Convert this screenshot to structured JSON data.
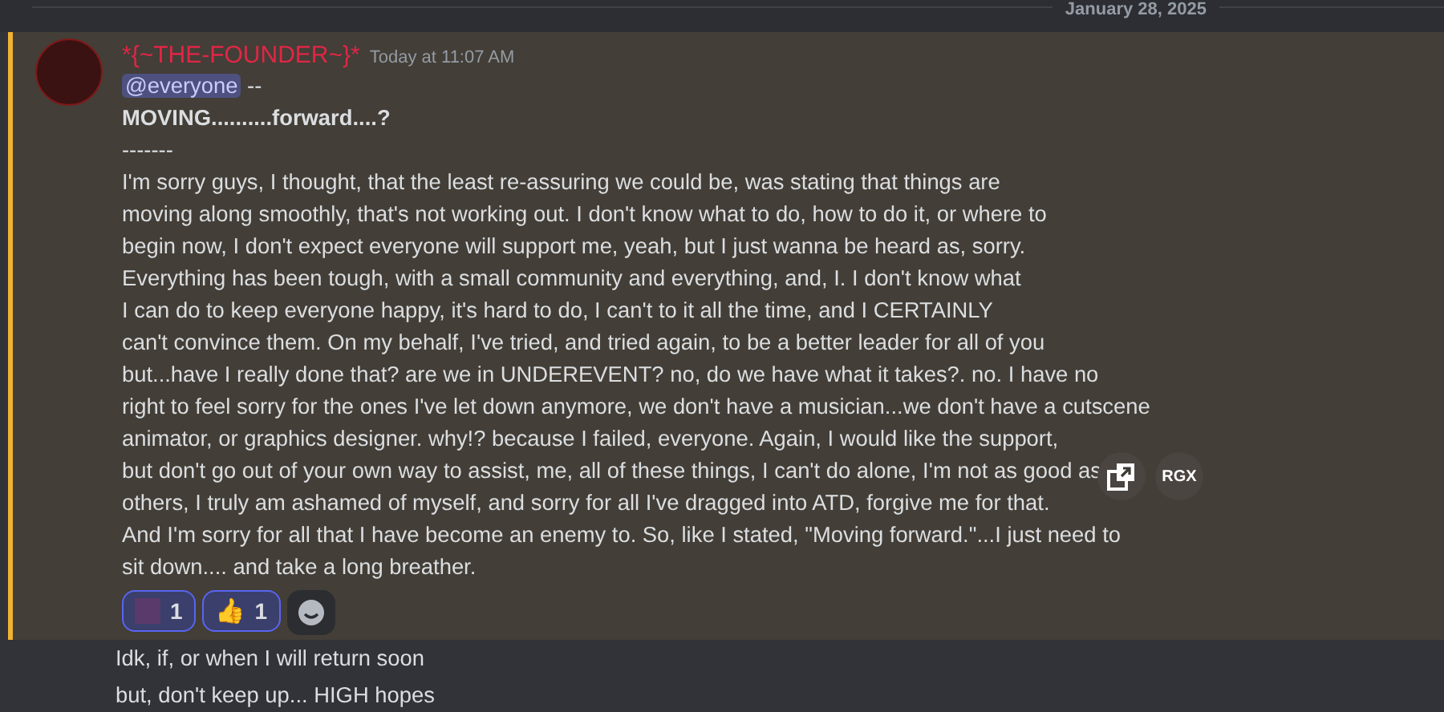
{
  "date_divider": "January 28, 2025",
  "message": {
    "author": "*{~THE-FOUNDER~}*",
    "timestamp": "Today at 11:07 AM",
    "mention": "@everyone",
    "mention_suffix": " --",
    "heading": "MOVING..........forward....?",
    "separator": "-------",
    "lines": [
      "I'm sorry guys, I thought, that the least re-assuring we could be, was stating that things are",
      "moving along smoothly, that's not working out. I don't know what to do, how to do it, or where to",
      "begin now, I don't expect everyone will support me, yeah, but I just wanna be heard as, sorry.",
      "Everything has been tough, with a small community and everything, and, I. I don't know what",
      "I can do to keep everyone happy, it's hard to do, I can't to it all the time, and I CERTAINLY",
      "can't convince them. On my behalf, I've tried, and tried again, to be a better leader for all of you",
      "but...have I really done that? are we in UNDEREVENT? no, do we have what it takes?. no. I have no",
      "right to feel sorry for the ones I've let down anymore, we don't have a musician...we don't have a cutscene",
      "animator, or graphics designer. why!? because I failed, everyone. Again, I would like the support,",
      "but don't go out of your own way to assist, me, all of these things, I can't do alone, I'm not as good as",
      "others, I truly am ashamed of myself, and sorry for all I've dragged into ATD, forgive me for that.",
      "And I'm sorry for all that I have become an enemy to. So, like I stated, \"Moving forward.\"...I just need to",
      "sit down.... and take a long breather."
    ],
    "reactions": [
      {
        "kind": "image",
        "count": "1",
        "selected": true
      },
      {
        "kind": "emoji",
        "emoji": "👍",
        "count": "1",
        "selected": true
      }
    ],
    "hover_actions": [
      {
        "kind": "icon"
      },
      {
        "kind": "text",
        "label": "RGX"
      }
    ]
  },
  "followups": [
    "Idk, if, or when I will return soon",
    "but, don't keep up... HIGH hopes"
  ]
}
